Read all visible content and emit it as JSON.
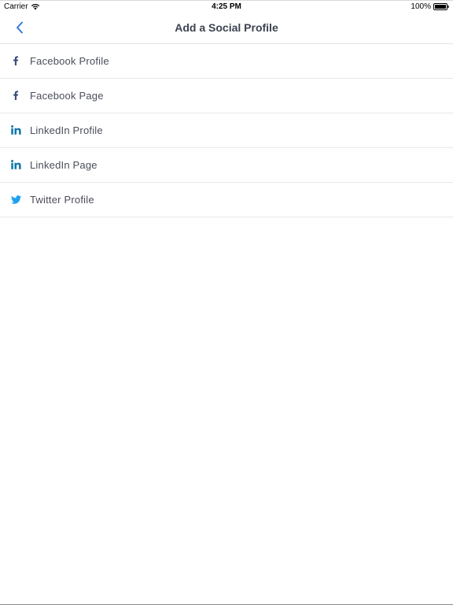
{
  "status_bar": {
    "carrier": "Carrier",
    "time": "4:25 PM",
    "battery": "100%"
  },
  "nav": {
    "title": "Add a Social Profile",
    "back_icon": "chevron-left-icon"
  },
  "colors": {
    "accent": "#2f6fd6",
    "facebook": "#3b4f7a",
    "linkedin": "#0e76a8",
    "twitter": "#1da1f2",
    "title": "#3d4251",
    "label": "#4a4e5a"
  },
  "items": [
    {
      "label": "Facebook Profile",
      "icon": "facebook-icon"
    },
    {
      "label": "Facebook Page",
      "icon": "facebook-icon"
    },
    {
      "label": "LinkedIn Profile",
      "icon": "linkedin-icon"
    },
    {
      "label": "LinkedIn Page",
      "icon": "linkedin-icon"
    },
    {
      "label": "Twitter Profile",
      "icon": "twitter-icon"
    }
  ]
}
